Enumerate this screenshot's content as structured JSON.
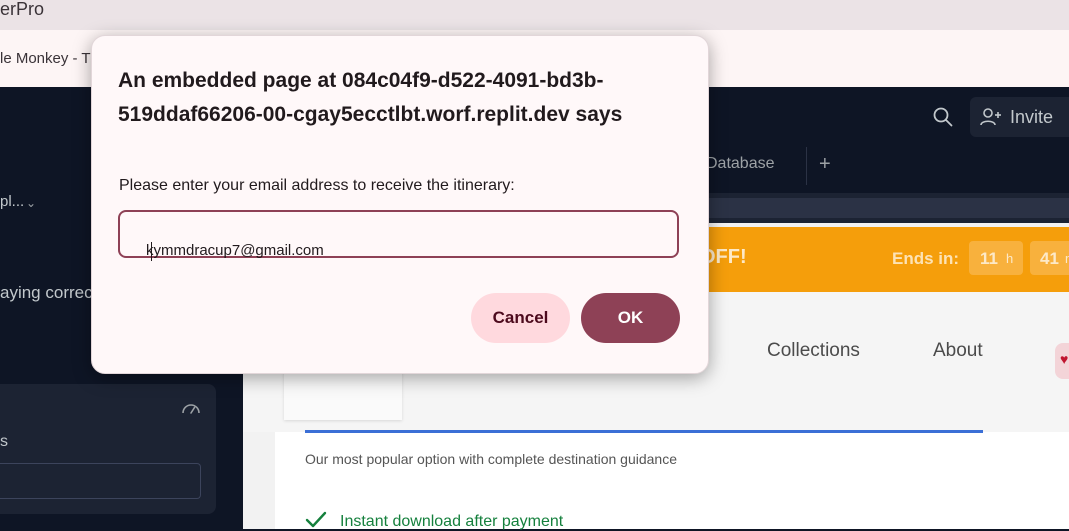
{
  "browser": {
    "window_title": "erPro",
    "tab_title": "le Monkey - T"
  },
  "ide": {
    "invite_label": "Invite",
    "tab_database": "Database",
    "tab_add": "+",
    "left_select": "pl...",
    "left_text": "aying correct",
    "left_label": "s"
  },
  "preview": {
    "promo_off": "OFF!",
    "ends_in": "Ends in:",
    "timer": [
      {
        "value": "11",
        "unit": "h"
      },
      {
        "value": "41",
        "unit": "m"
      }
    ],
    "nav": [
      "Collections",
      "About"
    ],
    "popular_text": "Our most popular option with complete destination guidance",
    "feature": "Instant download after payment"
  },
  "dialog": {
    "title": "An embedded page at 084c04f9-d522-4091-bd3b-519ddaf66206-00-cgay5ecctlbt.worf.replit.dev says",
    "message": "Please enter your email address to receive the itinerary:",
    "input_value": "kymmdracup7@gmail.com",
    "cancel_label": "Cancel",
    "ok_label": "OK",
    "accent_color": "#8e4156"
  }
}
